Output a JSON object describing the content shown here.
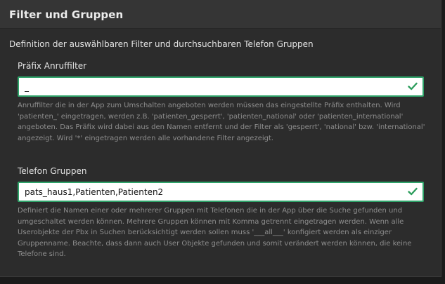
{
  "panel": {
    "title": "Filter und Gruppen",
    "description": "Definition der auswählbaren Filter und durchsuchbaren Telefon Gruppen"
  },
  "prefix_field": {
    "label": "Präfix Anruffilter",
    "value": "_",
    "help": "Anruffilter die in der App zum Umschalten angeboten werden müssen das eingestellte Präfix enthalten. Wird 'patienten_' eingetragen, werden z.B. 'patienten_gesperrt', 'patienten_national' oder 'patienten_international' angeboten. Das Präfix wird dabei aus den Namen entfernt und der Filter als 'gesperrt', 'national' bzw. 'international' angezeigt. Wird '*' eingetragen werden alle vorhandene Filter angezeigt."
  },
  "groups_field": {
    "label": "Telefon Gruppen",
    "value": "pats_haus1,Patienten,Patienten2",
    "help": "Definiert die Namen einer oder mehrerer Gruppen mit Telefonen die in der App über die Suche gefunden und umgeschaltet werden können. Mehrere Gruppen können mit Komma getrennt eingetragen werden. Wenn alle Userobjekte der Pbx in Suchen berücksichtigt werden sollen muss '___all___' konfigiert werden als einziger Gruppenname. Beachte, dass dann auch User Objekte gefunden und somit verändert werden können, die keine Telefone sind."
  },
  "colors": {
    "valid_border": "#2fa36a",
    "check_icon": "#2e9e5e"
  },
  "icons": {
    "valid": "check-icon"
  }
}
